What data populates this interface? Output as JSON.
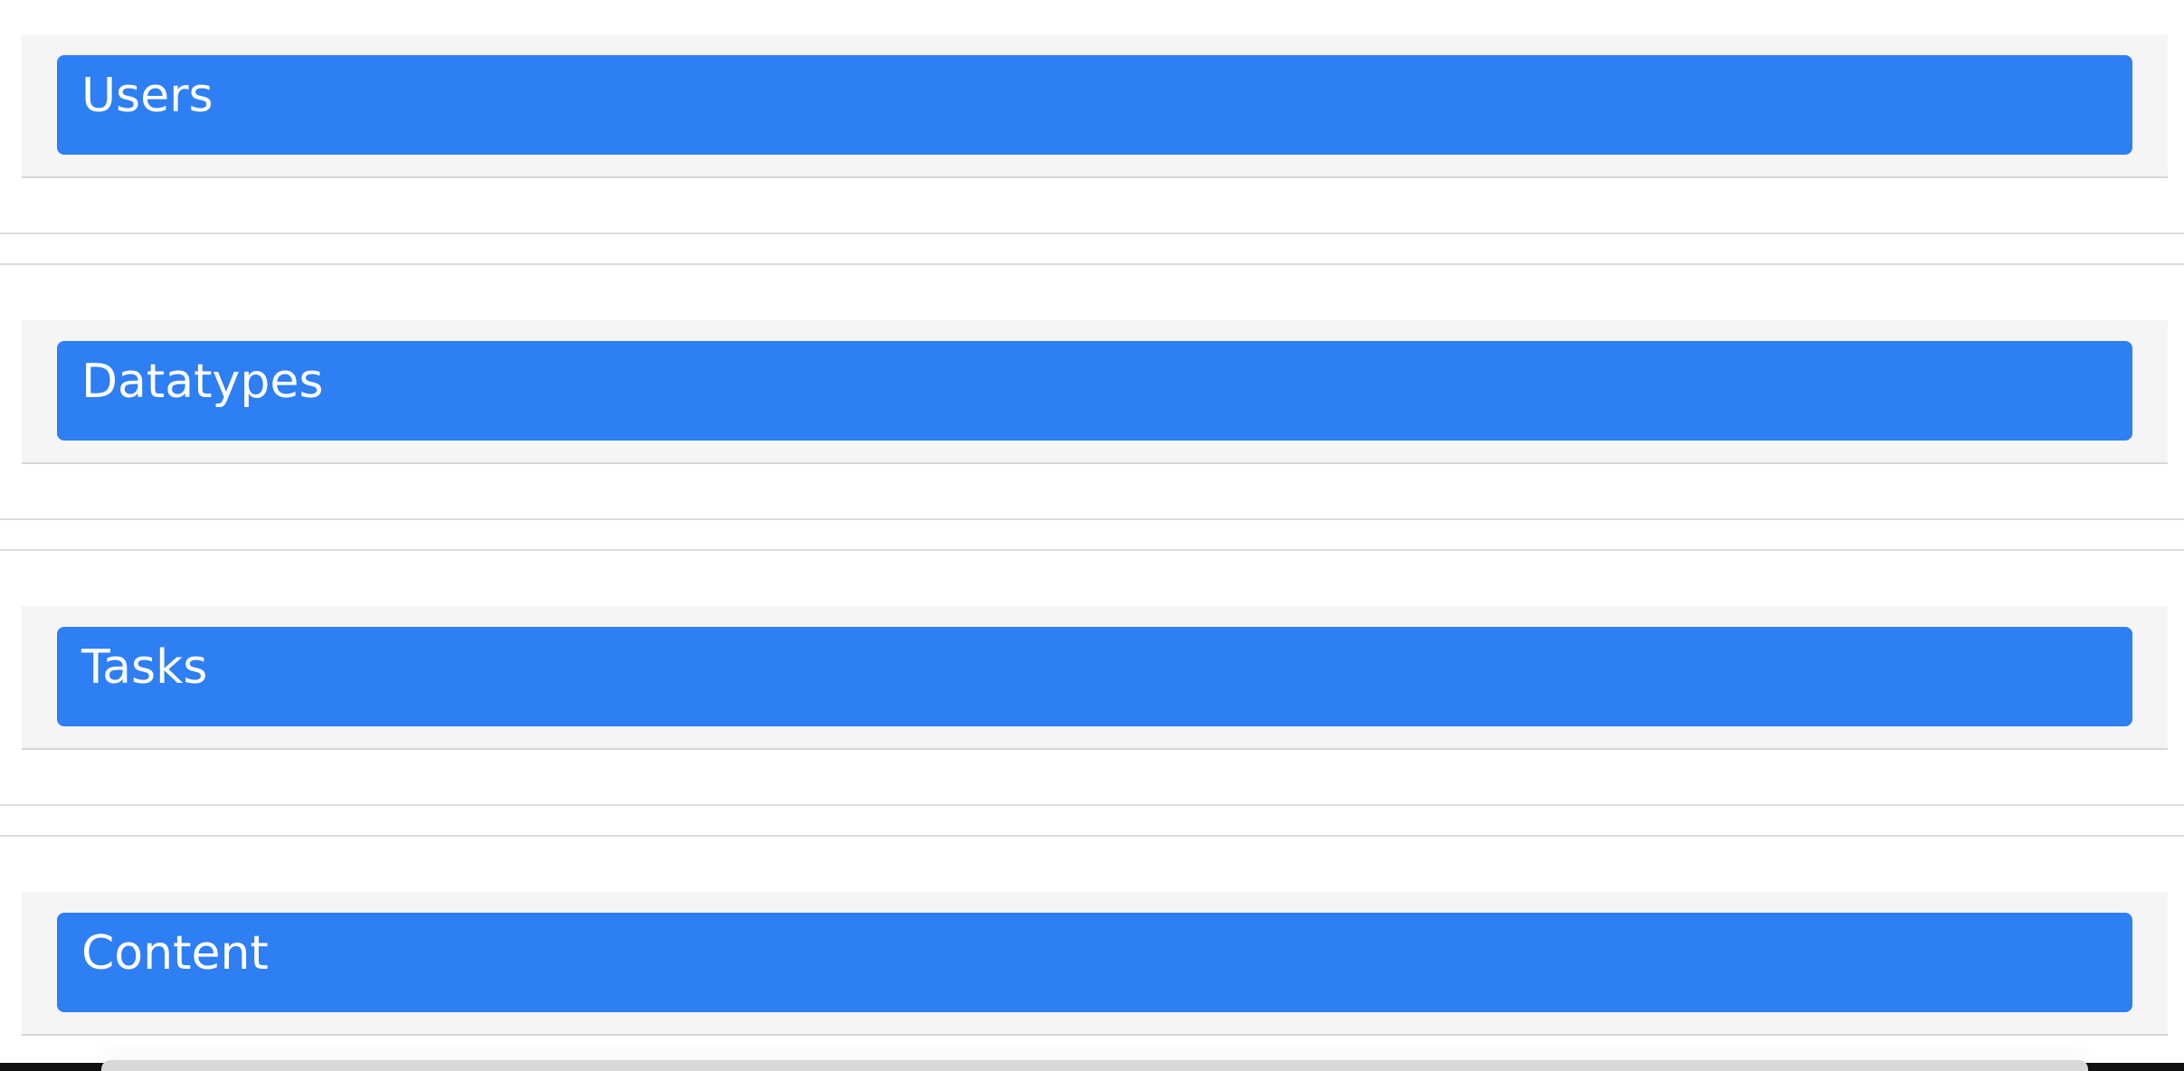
{
  "sections": [
    {
      "label": "Users"
    },
    {
      "label": "Datatypes"
    },
    {
      "label": "Tasks"
    },
    {
      "label": "Content"
    }
  ],
  "colors": {
    "button": "#2e7ef4",
    "panel_background": "#f5f5f5",
    "divider": "#dcdcdc",
    "label": "#ffffff"
  }
}
